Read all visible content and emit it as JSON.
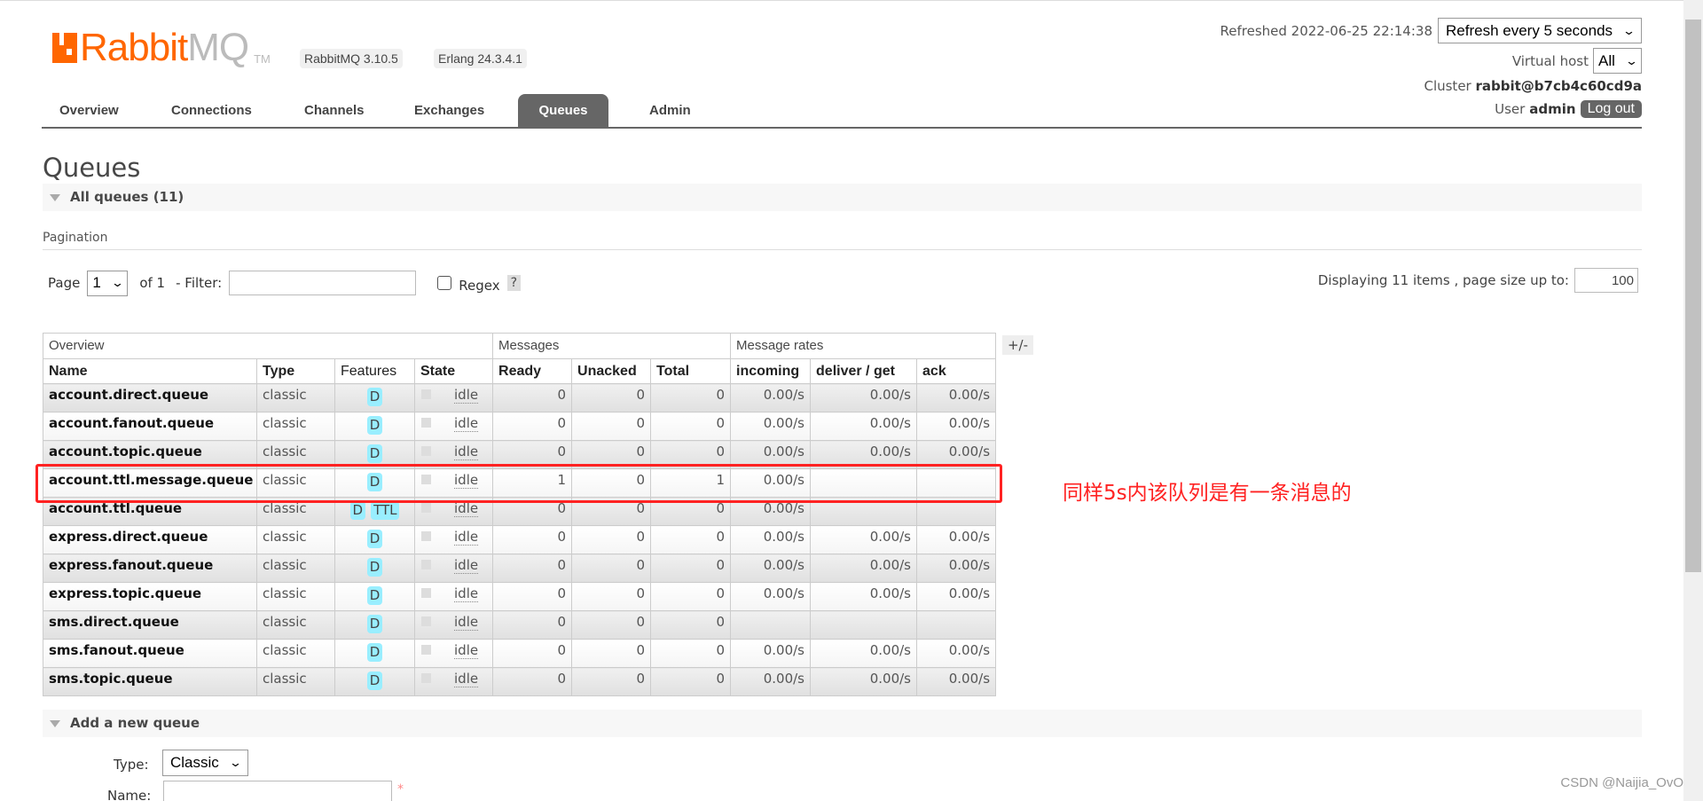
{
  "header": {
    "logo_text": "RabbitMQ",
    "logo_r": "Rabbit",
    "logo_m": "MQ",
    "logo_tm": "TM",
    "version_badge": "RabbitMQ 3.10.5",
    "erlang_badge": "Erlang 24.3.4.1",
    "refreshed": "Refreshed 2022-06-25 22:14:38",
    "refresh_select": "Refresh every 5 seconds",
    "vhost_label": "Virtual host",
    "vhost_select": "All",
    "cluster_label": "Cluster",
    "cluster_name": "rabbit@b7cb4c60cd9a",
    "user_label": "User",
    "user_name": "admin",
    "logout": "Log out"
  },
  "tabs": [
    {
      "label": "Overview"
    },
    {
      "label": "Connections"
    },
    {
      "label": "Channels"
    },
    {
      "label": "Exchanges"
    },
    {
      "label": "Queues",
      "active": true
    },
    {
      "label": "Admin"
    }
  ],
  "page_title": "Queues",
  "all_queues": "All queues (11)",
  "pagination": {
    "label": "Pagination",
    "page_label": "Page",
    "page_value": "1",
    "of": "of 1",
    "filter_label": "- Filter:",
    "filter_value": "",
    "regex_label": "Regex",
    "help": "?",
    "displaying": "Displaying 11 items , page size up to:",
    "page_size": "100"
  },
  "table": {
    "groups": [
      "Overview",
      "Messages",
      "Message rates"
    ],
    "columns": [
      "Name",
      "Type",
      "Features",
      "State",
      "Ready",
      "Unacked",
      "Total",
      "incoming",
      "deliver / get",
      "ack"
    ],
    "toggle": "+/-",
    "rows": [
      [
        "account.direct.queue",
        "classic",
        [
          "D"
        ],
        "idle",
        "0",
        "0",
        "0",
        "0.00/s",
        "0.00/s",
        "0.00/s"
      ],
      [
        "account.fanout.queue",
        "classic",
        [
          "D"
        ],
        "idle",
        "0",
        "0",
        "0",
        "0.00/s",
        "0.00/s",
        "0.00/s"
      ],
      [
        "account.topic.queue",
        "classic",
        [
          "D"
        ],
        "idle",
        "0",
        "0",
        "0",
        "0.00/s",
        "0.00/s",
        "0.00/s"
      ],
      [
        "account.ttl.message.queue",
        "classic",
        [
          "D"
        ],
        "idle",
        "1",
        "0",
        "1",
        "0.00/s",
        "",
        ""
      ],
      [
        "account.ttl.queue",
        "classic",
        [
          "D",
          "TTL"
        ],
        "idle",
        "0",
        "0",
        "0",
        "0.00/s",
        "",
        ""
      ],
      [
        "express.direct.queue",
        "classic",
        [
          "D"
        ],
        "idle",
        "0",
        "0",
        "0",
        "0.00/s",
        "0.00/s",
        "0.00/s"
      ],
      [
        "express.fanout.queue",
        "classic",
        [
          "D"
        ],
        "idle",
        "0",
        "0",
        "0",
        "0.00/s",
        "0.00/s",
        "0.00/s"
      ],
      [
        "express.topic.queue",
        "classic",
        [
          "D"
        ],
        "idle",
        "0",
        "0",
        "0",
        "0.00/s",
        "0.00/s",
        "0.00/s"
      ],
      [
        "sms.direct.queue",
        "classic",
        [
          "D"
        ],
        "idle",
        "0",
        "0",
        "0",
        "",
        "",
        ""
      ],
      [
        "sms.fanout.queue",
        "classic",
        [
          "D"
        ],
        "idle",
        "0",
        "0",
        "0",
        "0.00/s",
        "0.00/s",
        "0.00/s"
      ],
      [
        "sms.topic.queue",
        "classic",
        [
          "D"
        ],
        "idle",
        "0",
        "0",
        "0",
        "0.00/s",
        "0.00/s",
        "0.00/s"
      ]
    ]
  },
  "annotation": "同样5s内该队列是有一条消息的",
  "add_queue": {
    "title": "Add a new queue",
    "type_label": "Type:",
    "type_value": "Classic",
    "name_label": "Name:",
    "name_value": "",
    "required": "*"
  },
  "watermark": "CSDN @Naijia_OvO",
  "colors": {
    "brand": "#ff6600",
    "annotation": "#ff2222",
    "feature_badge": "#99eeff"
  }
}
